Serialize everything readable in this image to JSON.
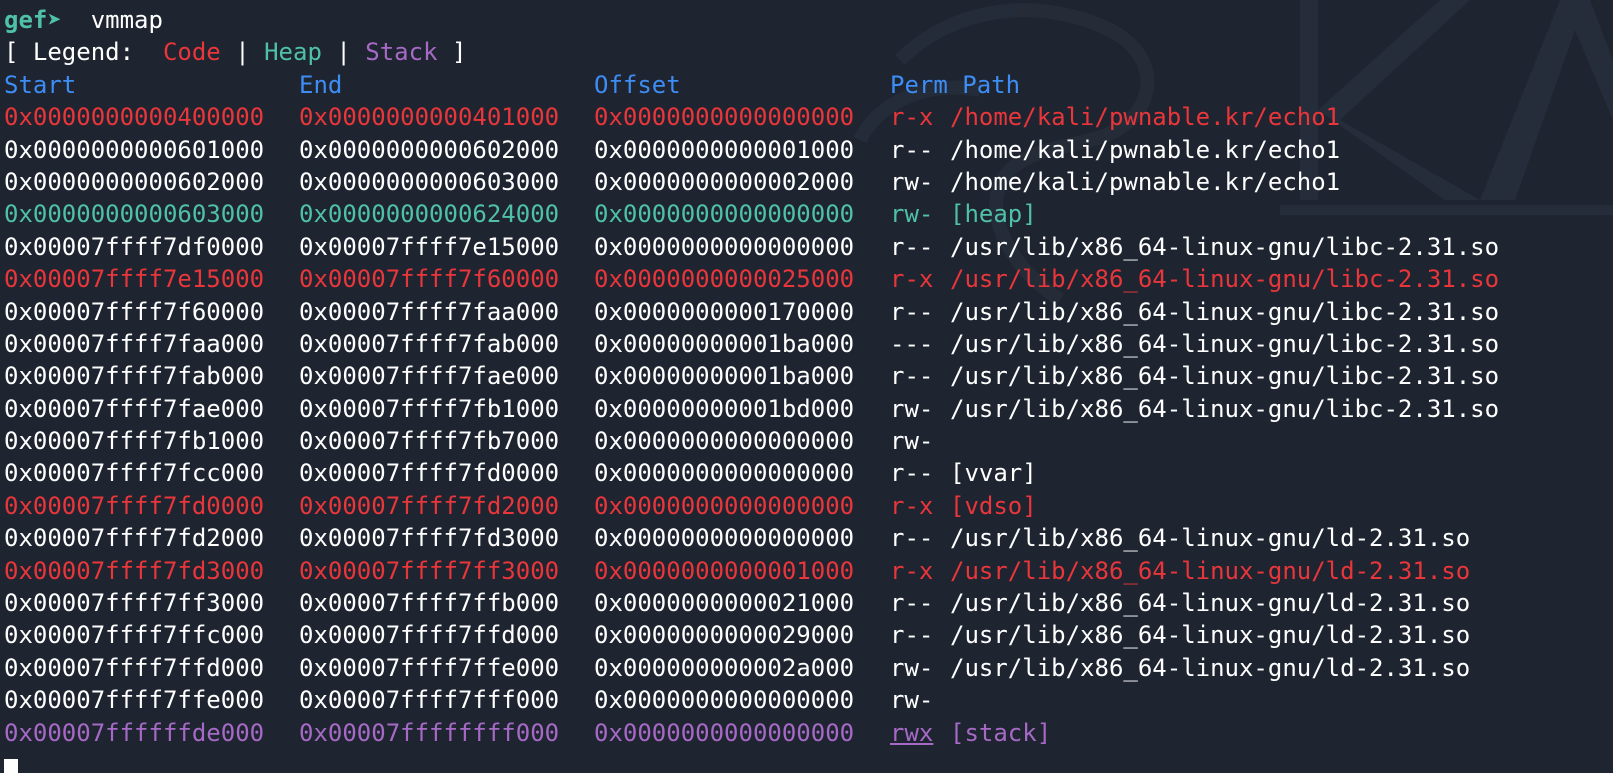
{
  "prompt": {
    "label": "gef➤",
    "command": "vmmap"
  },
  "legend": {
    "open": "[ Legend:",
    "code": "Code",
    "sep1": "|",
    "heap": "Heap",
    "sep2": "|",
    "stack": "Stack",
    "close": "]"
  },
  "header": {
    "start": "Start",
    "end": "End",
    "offset": "Offset",
    "perm_path": "Perm Path"
  },
  "colors": {
    "code": "#e8363b",
    "heap": "#4fc1a6",
    "stack": "#a66ac6",
    "header": "#3d8df5",
    "normal": "#ffffff",
    "background": "#1e2430"
  },
  "rows": [
    {
      "start": "0x0000000000400000",
      "end": "0x0000000000401000",
      "offset": "0x0000000000000000",
      "perm": "r-x",
      "path": "/home/kali/pwnable.kr/echo1",
      "kind": "code"
    },
    {
      "start": "0x0000000000601000",
      "end": "0x0000000000602000",
      "offset": "0x0000000000001000",
      "perm": "r--",
      "path": "/home/kali/pwnable.kr/echo1",
      "kind": "normal"
    },
    {
      "start": "0x0000000000602000",
      "end": "0x0000000000603000",
      "offset": "0x0000000000002000",
      "perm": "rw-",
      "path": "/home/kali/pwnable.kr/echo1",
      "kind": "normal"
    },
    {
      "start": "0x0000000000603000",
      "end": "0x0000000000624000",
      "offset": "0x0000000000000000",
      "perm": "rw-",
      "path": "[heap]",
      "kind": "heap"
    },
    {
      "start": "0x00007ffff7df0000",
      "end": "0x00007ffff7e15000",
      "offset": "0x0000000000000000",
      "perm": "r--",
      "path": "/usr/lib/x86_64-linux-gnu/libc-2.31.so",
      "kind": "normal"
    },
    {
      "start": "0x00007ffff7e15000",
      "end": "0x00007ffff7f60000",
      "offset": "0x0000000000025000",
      "perm": "r-x",
      "path": "/usr/lib/x86_64-linux-gnu/libc-2.31.so",
      "kind": "code"
    },
    {
      "start": "0x00007ffff7f60000",
      "end": "0x00007ffff7faa000",
      "offset": "0x0000000000170000",
      "perm": "r--",
      "path": "/usr/lib/x86_64-linux-gnu/libc-2.31.so",
      "kind": "normal"
    },
    {
      "start": "0x00007ffff7faa000",
      "end": "0x00007ffff7fab000",
      "offset": "0x00000000001ba000",
      "perm": "---",
      "path": "/usr/lib/x86_64-linux-gnu/libc-2.31.so",
      "kind": "normal"
    },
    {
      "start": "0x00007ffff7fab000",
      "end": "0x00007ffff7fae000",
      "offset": "0x00000000001ba000",
      "perm": "r--",
      "path": "/usr/lib/x86_64-linux-gnu/libc-2.31.so",
      "kind": "normal"
    },
    {
      "start": "0x00007ffff7fae000",
      "end": "0x00007ffff7fb1000",
      "offset": "0x00000000001bd000",
      "perm": "rw-",
      "path": "/usr/lib/x86_64-linux-gnu/libc-2.31.so",
      "kind": "normal"
    },
    {
      "start": "0x00007ffff7fb1000",
      "end": "0x00007ffff7fb7000",
      "offset": "0x0000000000000000",
      "perm": "rw-",
      "path": "",
      "kind": "normal"
    },
    {
      "start": "0x00007ffff7fcc000",
      "end": "0x00007ffff7fd0000",
      "offset": "0x0000000000000000",
      "perm": "r--",
      "path": "[vvar]",
      "kind": "normal"
    },
    {
      "start": "0x00007ffff7fd0000",
      "end": "0x00007ffff7fd2000",
      "offset": "0x0000000000000000",
      "perm": "r-x",
      "path": "[vdso]",
      "kind": "code"
    },
    {
      "start": "0x00007ffff7fd2000",
      "end": "0x00007ffff7fd3000",
      "offset": "0x0000000000000000",
      "perm": "r--",
      "path": "/usr/lib/x86_64-linux-gnu/ld-2.31.so",
      "kind": "normal"
    },
    {
      "start": "0x00007ffff7fd3000",
      "end": "0x00007ffff7ff3000",
      "offset": "0x0000000000001000",
      "perm": "r-x",
      "path": "/usr/lib/x86_64-linux-gnu/ld-2.31.so",
      "kind": "code"
    },
    {
      "start": "0x00007ffff7ff3000",
      "end": "0x00007ffff7ffb000",
      "offset": "0x0000000000021000",
      "perm": "r--",
      "path": "/usr/lib/x86_64-linux-gnu/ld-2.31.so",
      "kind": "normal"
    },
    {
      "start": "0x00007ffff7ffc000",
      "end": "0x00007ffff7ffd000",
      "offset": "0x0000000000029000",
      "perm": "r--",
      "path": "/usr/lib/x86_64-linux-gnu/ld-2.31.so",
      "kind": "normal"
    },
    {
      "start": "0x00007ffff7ffd000",
      "end": "0x00007ffff7ffe000",
      "offset": "0x000000000002a000",
      "perm": "rw-",
      "path": "/usr/lib/x86_64-linux-gnu/ld-2.31.so",
      "kind": "normal"
    },
    {
      "start": "0x00007ffff7ffe000",
      "end": "0x00007ffff7fff000",
      "offset": "0x0000000000000000",
      "perm": "rw-",
      "path": "",
      "kind": "normal"
    },
    {
      "start": "0x00007ffffffde000",
      "end": "0x00007ffffffff000",
      "offset": "0x0000000000000000",
      "perm": "rwx",
      "path": "[stack]",
      "kind": "stack",
      "perm_underline": true
    }
  ]
}
